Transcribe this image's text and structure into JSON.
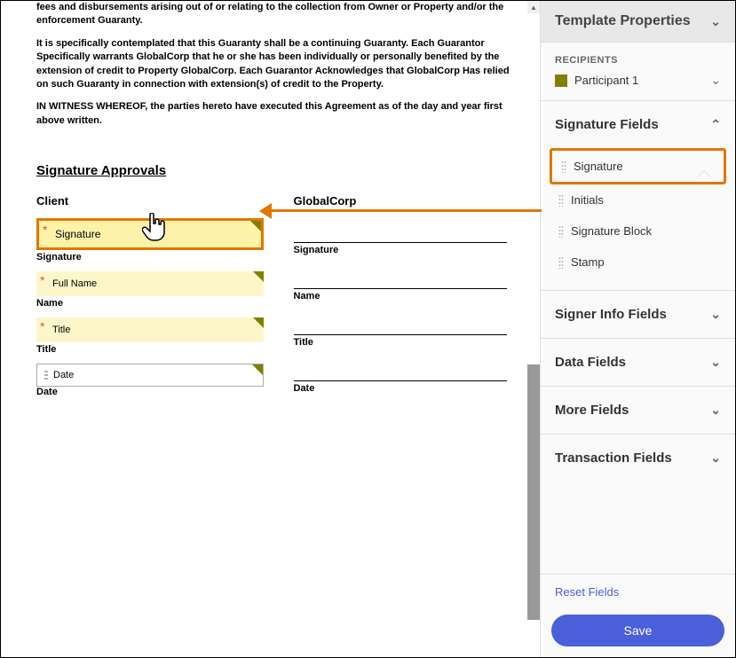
{
  "document": {
    "para1": "fees and disbursements arising out of or relating to the collection from Owner or Property and/or the enforcement Guaranty.",
    "para2": "It is specifically contemplated that this Guaranty shall be a continuing Guaranty. Each Guarantor Specifically warrants GlobalCorp that he or she has been individually or personally benefited by the extension of credit to Property GlobalCorp. Each Guarantor Acknowledges that GlobalCorp Has relied on such Guaranty in connection with extension(s) of credit to the Property.",
    "para3": "IN WITNESS WHEREOF, the parties hereto have executed this Agreement as of the day and year first above written.",
    "section_title": "Signature Approvals",
    "client_header": "Client",
    "globalcorp_header": "GlobalCorp",
    "labels": {
      "signature": "Signature",
      "name": "Name",
      "title": "Title",
      "date": "Date"
    },
    "fields": {
      "signature": "Signature",
      "full_name": "Full Name",
      "title": "Title",
      "date": "Date"
    }
  },
  "sidebar": {
    "title": "Template Properties",
    "recipients_label": "RECIPIENTS",
    "participant": "Participant 1",
    "sections": {
      "signature_fields": "Signature Fields",
      "signer_info": "Signer Info Fields",
      "data_fields": "Data Fields",
      "more_fields": "More Fields",
      "transaction_fields": "Transaction Fields"
    },
    "signature_field_items": {
      "signature": "Signature",
      "initials": "Initials",
      "signature_block": "Signature Block",
      "stamp": "Stamp"
    },
    "reset": "Reset Fields",
    "save": "Save"
  }
}
